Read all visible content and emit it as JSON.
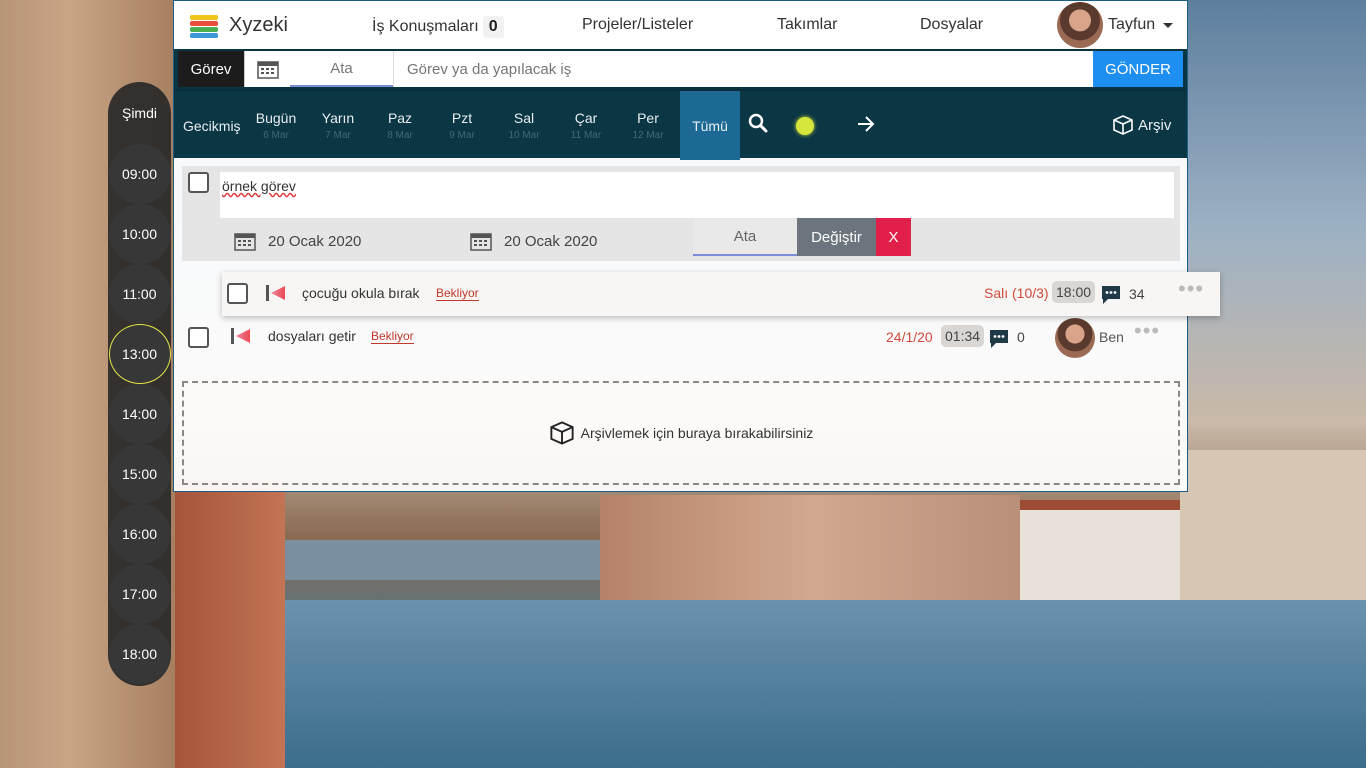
{
  "app": {
    "brand": "Xyzeki",
    "logo_colors": [
      "#f0c419",
      "#e94e3c",
      "#4cb050",
      "#3a98d8"
    ]
  },
  "nav": {
    "conversations_label": "İş Konuşmaları",
    "conversations_count": "0",
    "projects_label": "Projeler/Listeler",
    "teams_label": "Takımlar",
    "files_label": "Dosyalar",
    "user_name": "Tayfun"
  },
  "entry": {
    "type_label": "Görev",
    "assign_label": "Ata",
    "placeholder": "Görev ya da yapılacak iş",
    "send_label": "GÖNDER"
  },
  "days": {
    "overdue_label": "Gecikmiş",
    "items": [
      {
        "name": "Bugün",
        "date": "6 Mar"
      },
      {
        "name": "Yarın",
        "date": "7 Mar"
      },
      {
        "name": "Paz",
        "date": "8 Mar"
      },
      {
        "name": "Pzt",
        "date": "9 Mar"
      },
      {
        "name": "Sal",
        "date": "10 Mar"
      },
      {
        "name": "Çar",
        "date": "11 Mar"
      },
      {
        "name": "Per",
        "date": "12 Mar"
      }
    ],
    "all_label": "Tümü",
    "archive_label": "Arşiv"
  },
  "timeline": {
    "now_label": "Şimdi",
    "hours": [
      "09:00",
      "10:00",
      "11:00",
      "13:00",
      "14:00",
      "15:00",
      "16:00",
      "17:00",
      "18:00"
    ],
    "current_hour": "13:00"
  },
  "edit_task": {
    "text": "örnek görev",
    "start_date": "20 Ocak 2020",
    "end_date": "20 Ocak 2020",
    "assign_label": "Ata",
    "change_label": "Değiştir",
    "cancel_label": "X"
  },
  "tasks": [
    {
      "title": "çocuğu okula bırak",
      "status": "Bekliyor",
      "due": "Salı (10/3)",
      "time": "18:00",
      "comments": "34"
    },
    {
      "title": "dosyaları getir",
      "status": "Bekliyor",
      "due": "24/1/20",
      "time": "01:34",
      "comments": "0",
      "assignee": "Ben"
    }
  ],
  "dropzone": {
    "text": "Arşivlemek için buraya bırakabilirsiniz"
  }
}
